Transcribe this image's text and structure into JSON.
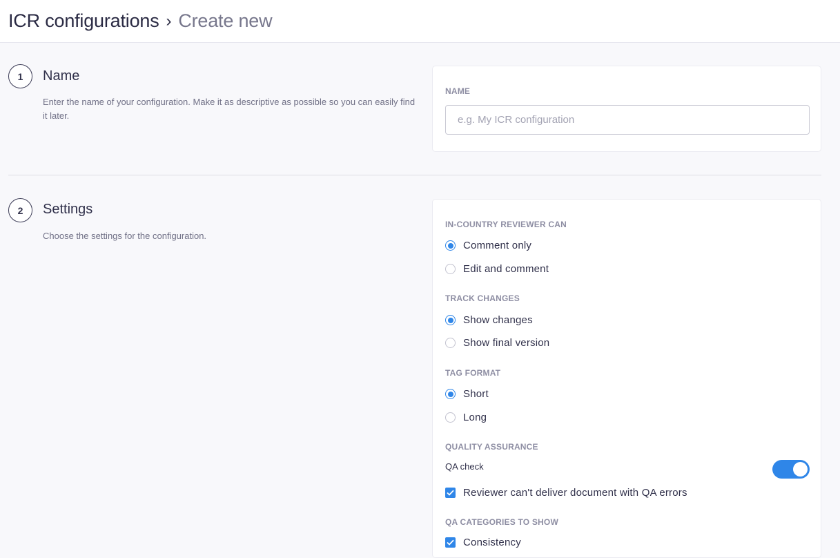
{
  "breadcrumb": {
    "root": "ICR configurations",
    "separator": "›",
    "current": "Create new"
  },
  "sections": {
    "name": {
      "step": "1",
      "title": "Name",
      "description": "Enter the name of your configuration. Make it as descriptive as possible so you can easily find it later.",
      "field_label": "NAME",
      "input_value": "",
      "input_placeholder": "e.g. My ICR configuration"
    },
    "settings": {
      "step": "2",
      "title": "Settings",
      "description": "Choose the settings for the configuration.",
      "reviewer": {
        "label": "IN-COUNTRY REVIEWER CAN",
        "options": [
          "Comment only",
          "Edit and comment"
        ],
        "selected": "Comment only"
      },
      "track_changes": {
        "label": "TRACK CHANGES",
        "options": [
          "Show changes",
          "Show final version"
        ],
        "selected": "Show changes"
      },
      "tag_format": {
        "label": "TAG FORMAT",
        "options": [
          "Short",
          "Long"
        ],
        "selected": "Short"
      },
      "quality_assurance": {
        "label": "QUALITY ASSURANCE",
        "qa_check_label": "QA check",
        "qa_check_enabled": true,
        "block_delivery_label": "Reviewer can't deliver document with QA errors",
        "block_delivery_checked": true
      },
      "qa_categories": {
        "label": "QA CATEGORIES TO SHOW",
        "items": [
          {
            "label": "Consistency",
            "checked": true
          }
        ]
      }
    }
  },
  "colors": {
    "accent": "#2f86e8",
    "text": "#30304a",
    "muted": "#707086",
    "label": "#8e8ea3"
  }
}
